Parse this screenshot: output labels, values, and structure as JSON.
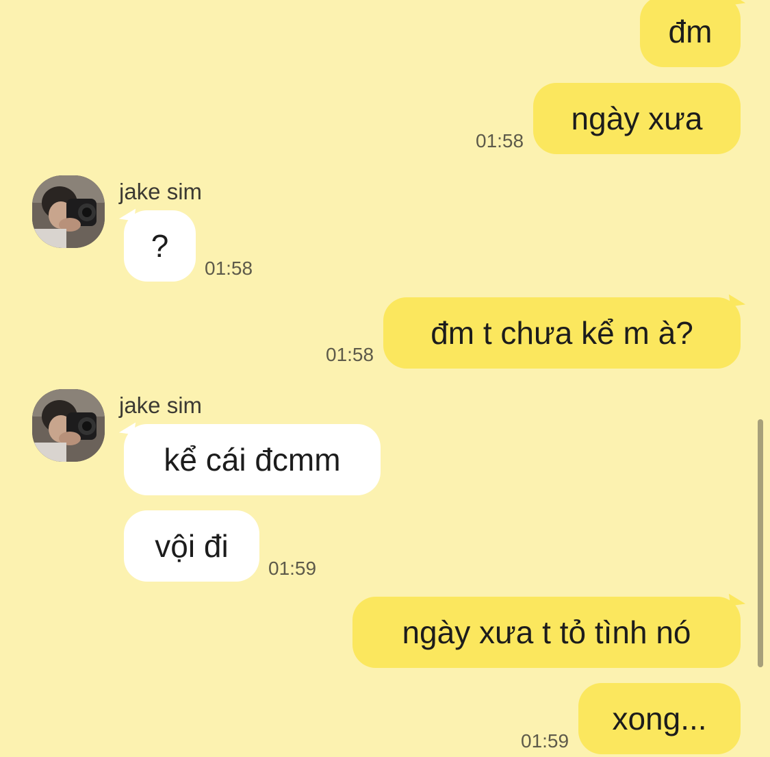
{
  "contact": {
    "name": "jake sim"
  },
  "messages": [
    {
      "side": "out",
      "text": "đm"
    },
    {
      "side": "out",
      "text": "ngày xưa",
      "time": "01:58"
    },
    {
      "side": "in",
      "sender": "jake sim",
      "text": "?",
      "time": "01:58"
    },
    {
      "side": "out",
      "text": "đm t chưa kể m à?",
      "time": "01:58"
    },
    {
      "side": "in",
      "sender": "jake sim",
      "text": "kể cái đcmm"
    },
    {
      "side": "in",
      "text": "vội đi",
      "time": "01:59"
    },
    {
      "side": "out",
      "text": "ngày xưa t tỏ tình nó"
    },
    {
      "side": "out",
      "text": "xong...",
      "time": "01:59"
    }
  ],
  "icons": {
    "avatar": "avatar-photo"
  },
  "colors": {
    "background": "#fcf2b0",
    "outgoing_bubble": "#fbe75e",
    "incoming_bubble": "#ffffff"
  }
}
